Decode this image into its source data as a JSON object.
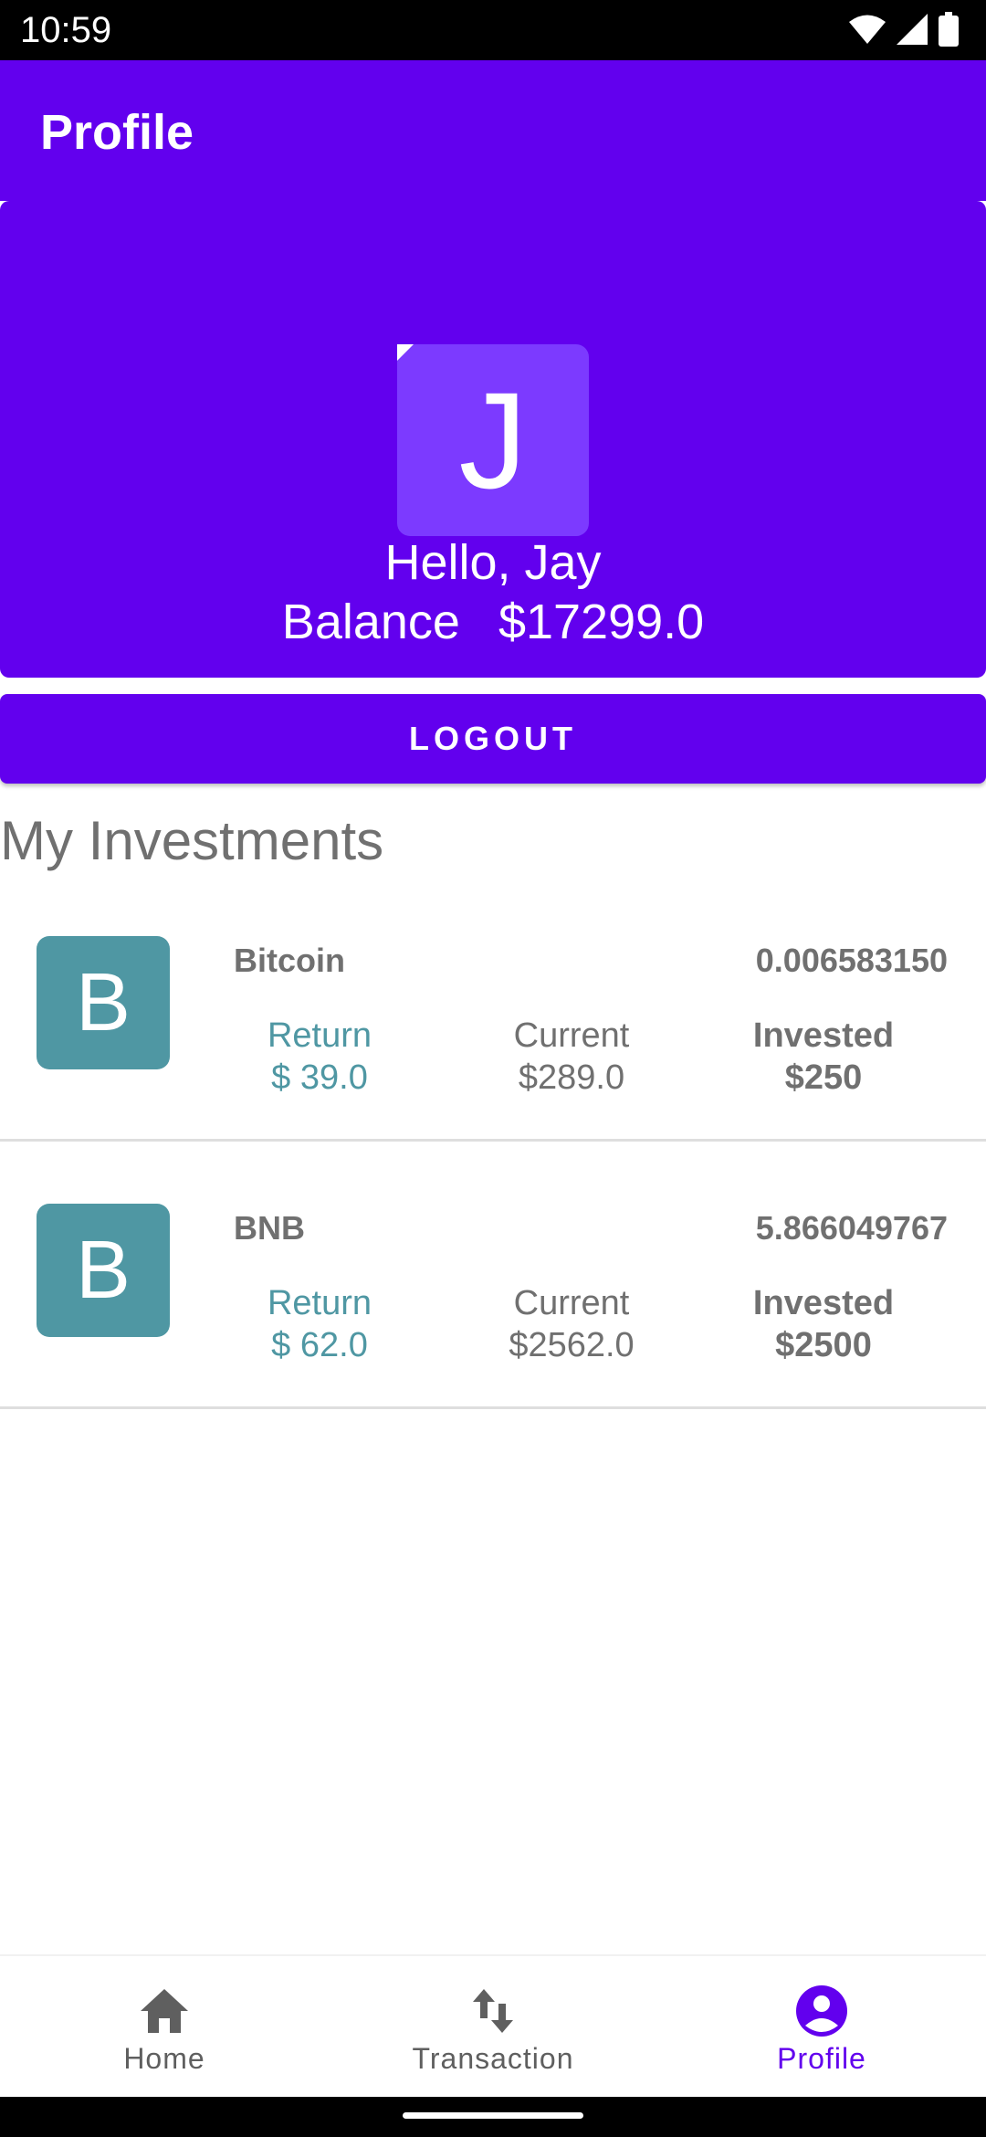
{
  "status_bar": {
    "time": "10:59",
    "icons": [
      "wifi-icon",
      "cellular-signal-icon",
      "battery-icon"
    ]
  },
  "app_bar": {
    "title": "Profile"
  },
  "profile": {
    "avatar_letter": "J",
    "greeting": "Hello, Jay",
    "balance_label": "Balance",
    "balance_value": "$17299.0"
  },
  "logout_label": "LOGOUT",
  "section_title": "My Investments",
  "investments": [
    {
      "icon_letter": "B",
      "name": "Bitcoin",
      "quantity": "0.006583150",
      "return_label": "Return",
      "return_value": "$ 39.0",
      "current_label": "Current",
      "current_value": "$289.0",
      "invested_label": "Invested",
      "invested_value": "$250"
    },
    {
      "icon_letter": "B",
      "name": "BNB",
      "quantity": "5.866049767",
      "return_label": "Return",
      "return_value": "$ 62.0",
      "current_label": "Current",
      "current_value": "$2562.0",
      "invested_label": "Invested",
      "invested_value": "$2500"
    }
  ],
  "bottom_nav": {
    "items": [
      {
        "label": "Home",
        "icon": "home-icon",
        "selected": false
      },
      {
        "label": "Transaction",
        "icon": "swap-vertical-icon",
        "selected": false
      },
      {
        "label": "Profile",
        "icon": "account-circle-icon",
        "selected": true
      }
    ]
  },
  "colors": {
    "primary": "#6200ee",
    "avatar_bg": "#7c3aff",
    "coin_icon_bg": "#4f97a3",
    "return_text": "#4f97a3",
    "muted_text": "#707070"
  }
}
